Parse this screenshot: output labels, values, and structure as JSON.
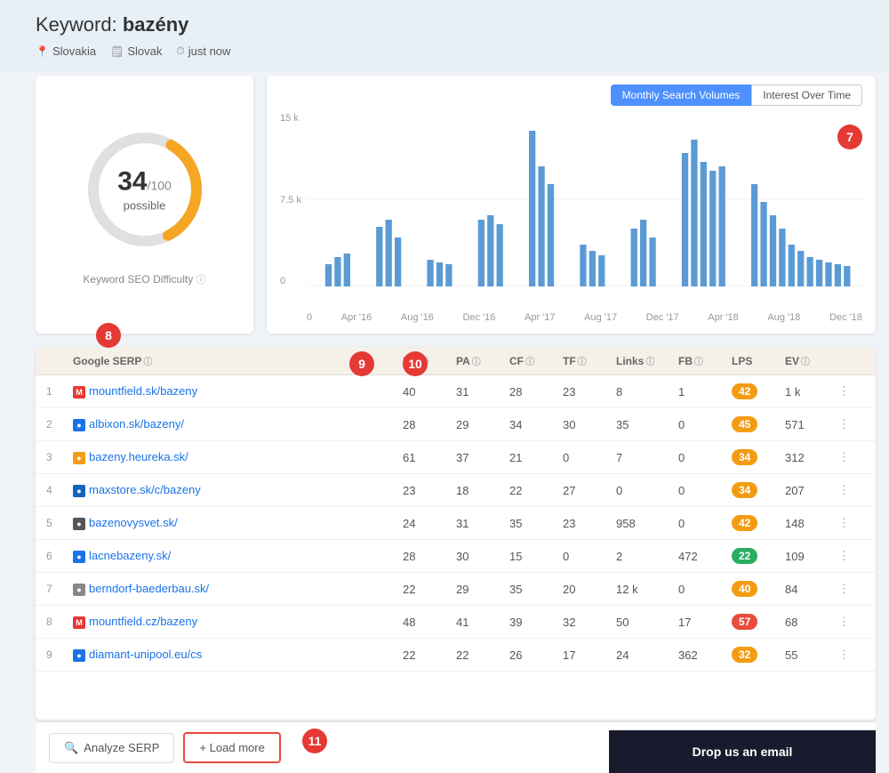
{
  "header": {
    "keyword_label": "Keyword: ",
    "keyword": "bazény",
    "meta": [
      {
        "icon": "📍",
        "text": "Slovakia"
      },
      {
        "icon": "🗒",
        "text": "Slovak"
      },
      {
        "icon": "⏱",
        "text": "just now"
      }
    ]
  },
  "score_card": {
    "score": "34",
    "max": "/100",
    "label": "possible",
    "seo_diff": "Keyword SEO Difficulty"
  },
  "chart": {
    "toggle_monthly": "Monthly Search Volumes",
    "toggle_interest": "Interest Over Time",
    "y_labels": [
      "15 k",
      "7.5 k",
      "0"
    ],
    "x_labels": [
      "Apr '16",
      "Aug '16",
      "Dec '16",
      "Apr '17",
      "Aug '17",
      "Dec '17",
      "Apr '18",
      "Aug '18",
      "Dec '18"
    ],
    "badge": "7"
  },
  "table": {
    "columns": [
      "#",
      "Google SERP",
      "DA",
      "PA",
      "CF",
      "TF",
      "Links",
      "FB",
      "LPS",
      "EV",
      ""
    ],
    "rows": [
      {
        "num": 1,
        "favicon": "M",
        "favicon_color": "#e53935",
        "url": "mountfield.sk/bazeny",
        "da": 40,
        "pa": 31,
        "cf": 28,
        "tf": 23,
        "links": 8,
        "fb": 1,
        "lps": 42,
        "lps_color": "orange",
        "ev": "1 k"
      },
      {
        "num": 2,
        "favicon": "🔷",
        "favicon_color": "#1a73e8",
        "url": "albixon.sk/bazeny/",
        "da": 28,
        "pa": 29,
        "cf": 34,
        "tf": 30,
        "links": 35,
        "fb": 0,
        "lps": 45,
        "lps_color": "orange",
        "ev": "571"
      },
      {
        "num": 3,
        "favicon": "🔶",
        "favicon_color": "#f39c12",
        "url": "bazeny.heureka.sk/",
        "da": 61,
        "pa": 37,
        "cf": 21,
        "tf": 0,
        "links": 7,
        "fb": 0,
        "lps": 34,
        "lps_color": "orange",
        "ev": "312"
      },
      {
        "num": 4,
        "favicon": "🔵",
        "favicon_color": "#1565c0",
        "url": "maxstore.sk/c/bazeny",
        "da": 23,
        "pa": 18,
        "cf": 22,
        "tf": 27,
        "links": 0,
        "fb": 0,
        "lps": 34,
        "lps_color": "orange",
        "ev": "207"
      },
      {
        "num": 5,
        "favicon": "🏪",
        "favicon_color": "#555",
        "url": "bazenovysvet.sk/",
        "da": 24,
        "pa": 31,
        "cf": 35,
        "tf": 23,
        "links": 958,
        "fb": 0,
        "lps": 42,
        "lps_color": "orange",
        "ev": "148"
      },
      {
        "num": 6,
        "favicon": "💧",
        "favicon_color": "#1a73e8",
        "url": "lacnebazeny.sk/",
        "da": 28,
        "pa": 30,
        "cf": 15,
        "tf": 0,
        "links": 2,
        "fb": 472,
        "lps": 22,
        "lps_color": "green",
        "ev": "109"
      },
      {
        "num": 7,
        "favicon": "🌐",
        "favicon_color": "#888",
        "url": "berndorf-baederbau.sk/",
        "da": 22,
        "pa": 29,
        "cf": 35,
        "tf": 20,
        "links": "12 k",
        "fb": 0,
        "lps": 40,
        "lps_color": "orange",
        "ev": "84"
      },
      {
        "num": 8,
        "favicon": "M",
        "favicon_color": "#e53935",
        "url": "mountfield.cz/bazeny",
        "da": 48,
        "pa": 41,
        "cf": 39,
        "tf": 32,
        "links": 50,
        "fb": 17,
        "lps": 57,
        "lps_color": "red",
        "ev": "68"
      },
      {
        "num": 9,
        "favicon": "💎",
        "favicon_color": "#1a73e8",
        "url": "diamant-unipool.eu/cs",
        "da": 22,
        "pa": 22,
        "cf": 26,
        "tf": 17,
        "links": 24,
        "fb": 362,
        "lps": 32,
        "lps_color": "orange",
        "ev": "55"
      }
    ]
  },
  "bottom": {
    "analyze_label": "Analyze SERP",
    "load_more_label": "+ Load more",
    "email_label": "Drop us an email"
  },
  "badges": {
    "b7": "7",
    "b8": "8",
    "b9": "9",
    "b10": "10",
    "b11": "11"
  }
}
